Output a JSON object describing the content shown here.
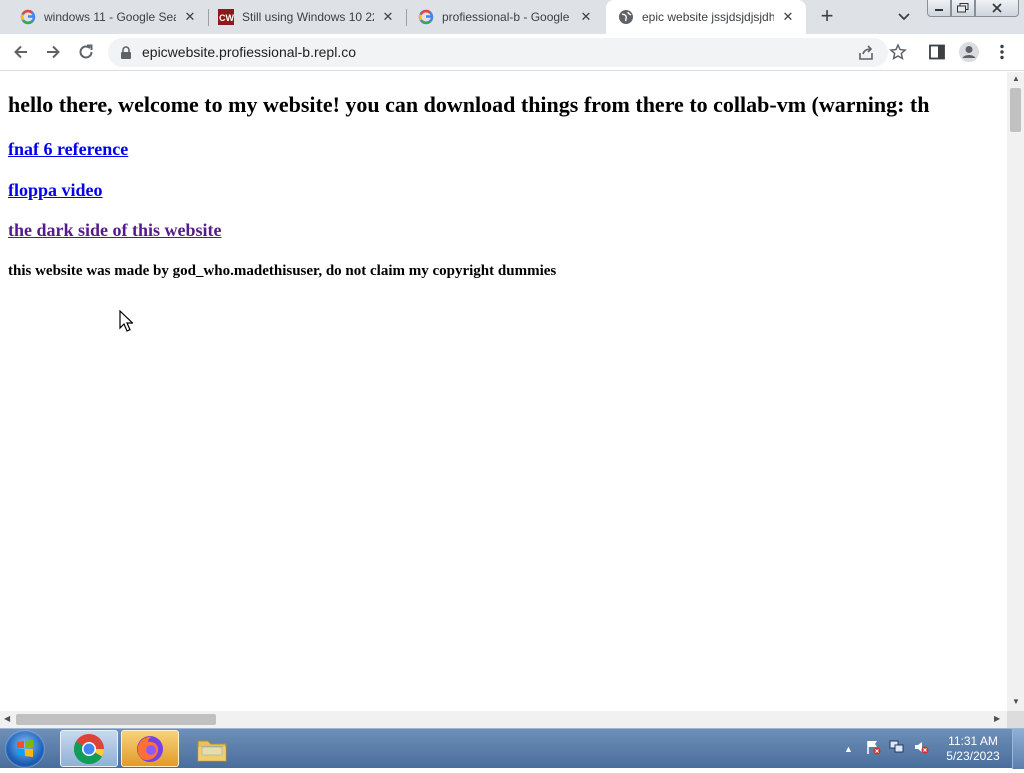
{
  "tabs": [
    {
      "title": "windows 11 - Google Sea",
      "favicon": "google-icon",
      "active": false
    },
    {
      "title": "Still using Windows 10 22",
      "favicon": "cw-icon",
      "active": false
    },
    {
      "title": "profiessional-b - Google",
      "favicon": "google-icon",
      "active": false
    },
    {
      "title": "epic website jssjdsjdjsjdh",
      "favicon": "globe-icon",
      "active": true
    }
  ],
  "toolbar": {
    "url": "epicwebsite.profiessional-b.repl.co"
  },
  "page": {
    "heading": "hello there, welcome to my website! you can download things from there to collab-vm (warning: th",
    "links": [
      {
        "label": "fnaf 6 reference",
        "visited": false
      },
      {
        "label": "floppa video",
        "visited": false
      },
      {
        "label": "the dark side of this website",
        "visited": true
      }
    ],
    "credit": "this website was made by god_who.madethisuser, do not claim my copyright dummies"
  },
  "taskbar": {
    "items": [
      "chrome",
      "firefox",
      "file-explorer"
    ],
    "time": "11:31 AM",
    "date": "5/23/2023"
  },
  "colors": {
    "link": "#0000ee",
    "visited": "#551a8b",
    "tabstrip": "#dee1e6",
    "taskbar": "#5a7fae"
  }
}
